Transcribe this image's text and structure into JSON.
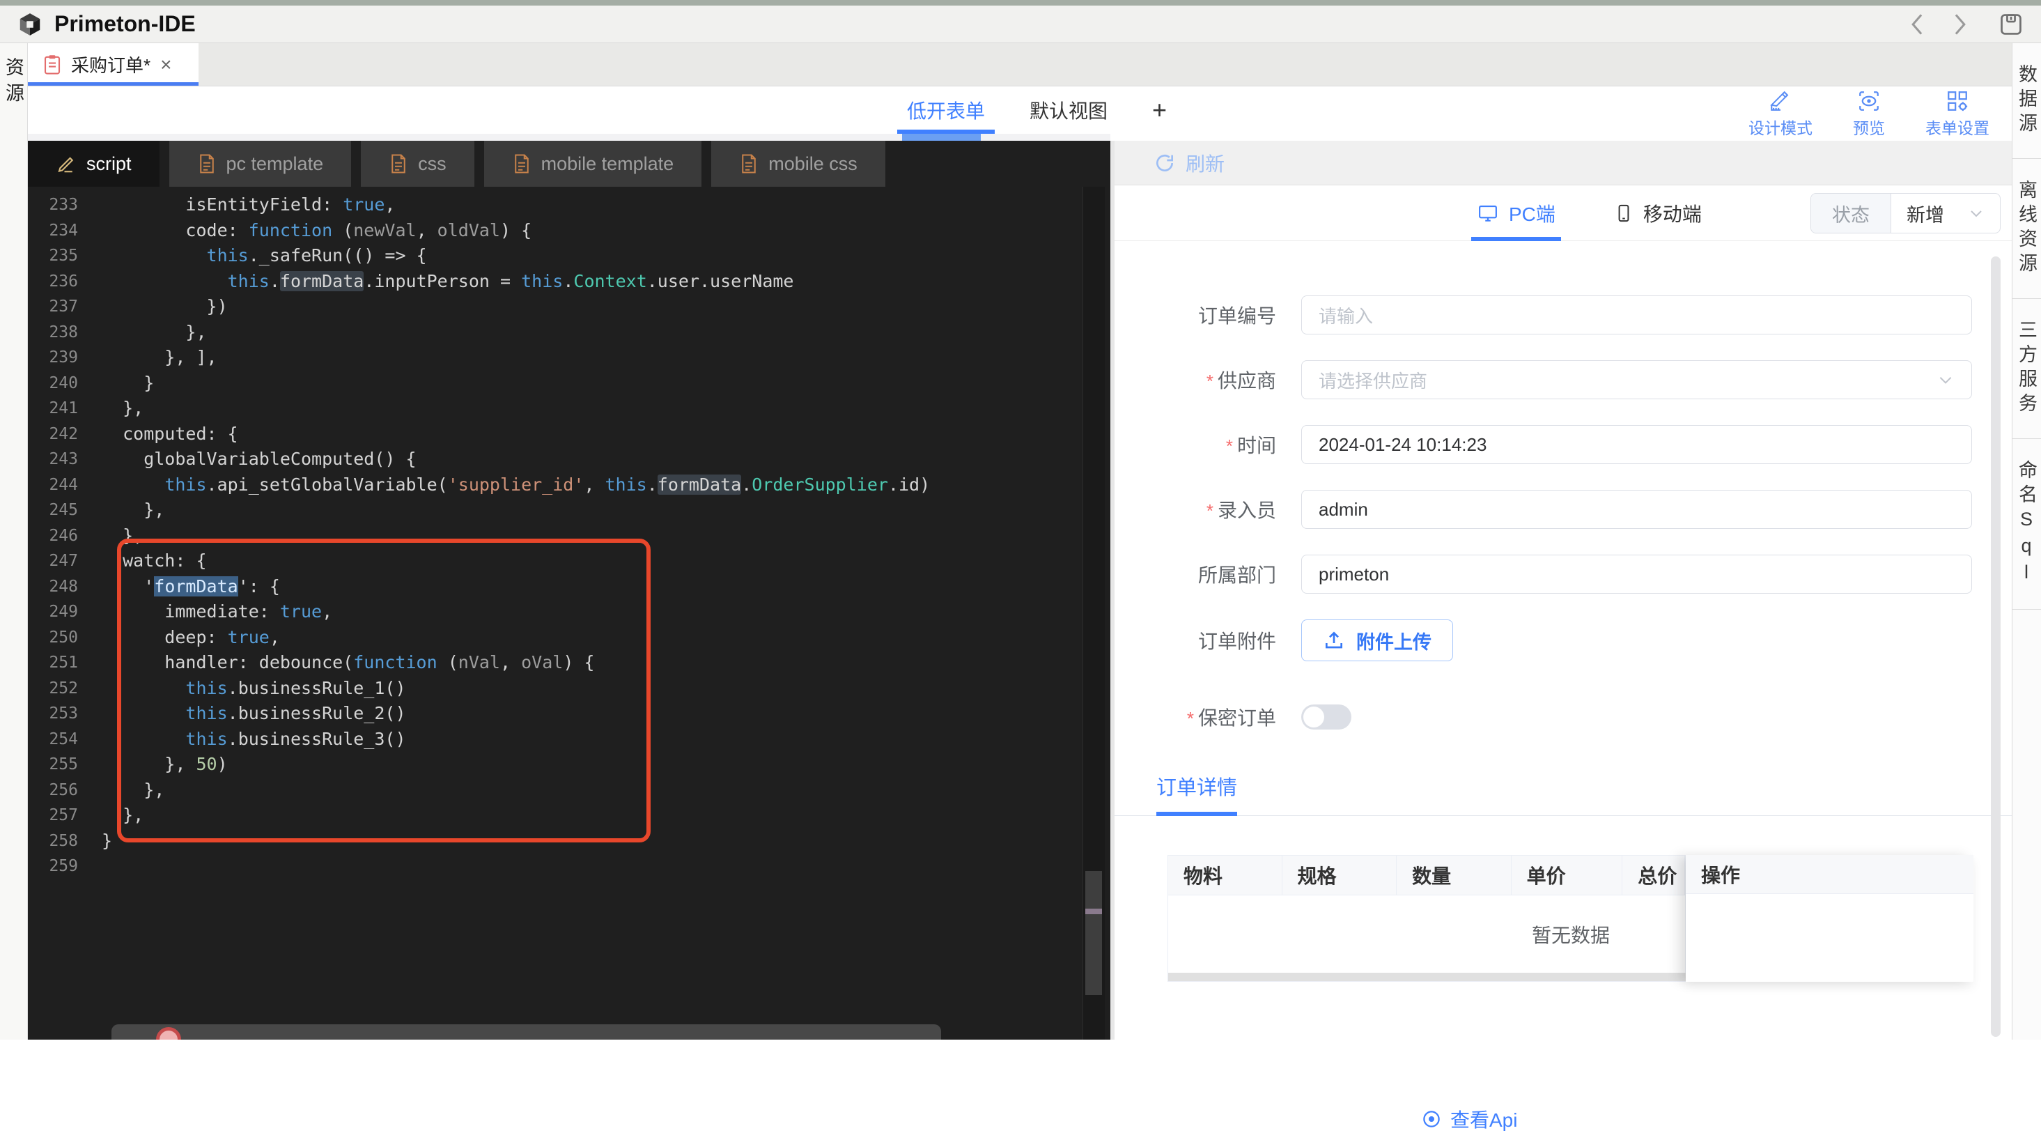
{
  "chrome": {
    "app_title": "Primeton-IDE"
  },
  "left_rail": {
    "label": "资源"
  },
  "doc_tab": {
    "title": "采购订单*",
    "close": "×"
  },
  "view_tabs": {
    "items": [
      {
        "label": "低开表单",
        "active": true
      },
      {
        "label": "默认视图",
        "active": false
      }
    ],
    "add": "+"
  },
  "top_actions": [
    {
      "label": "设计模式",
      "icon": "design-mode-icon"
    },
    {
      "label": "预览",
      "icon": "preview-icon"
    },
    {
      "label": "表单设置",
      "icon": "form-settings-icon"
    }
  ],
  "editor": {
    "tabs": [
      {
        "label": "script",
        "active": true,
        "icon": "pencil-icon"
      },
      {
        "label": "pc template",
        "active": false,
        "icon": "file-icon"
      },
      {
        "label": "css",
        "active": false,
        "icon": "file-icon"
      },
      {
        "label": "mobile template",
        "active": false,
        "icon": "file-icon"
      },
      {
        "label": "mobile css",
        "active": false,
        "icon": "file-icon"
      }
    ],
    "code": [
      {
        "n": 233,
        "s": [
          [
            "pln",
            "        isEntityField: "
          ],
          [
            "kw",
            "true"
          ],
          [
            "pln",
            ","
          ]
        ]
      },
      {
        "n": 234,
        "s": [
          [
            "pln",
            "        code: "
          ],
          [
            "kw",
            "function"
          ],
          [
            "pln",
            " ("
          ],
          [
            "prm",
            "newVal"
          ],
          [
            "pln",
            ", "
          ],
          [
            "prm",
            "oldVal"
          ],
          [
            "pln",
            ") {"
          ]
        ]
      },
      {
        "n": 235,
        "s": [
          [
            "pln",
            "          "
          ],
          [
            "kw",
            "this"
          ],
          [
            "pln",
            "._safeRun(() => {"
          ]
        ]
      },
      {
        "n": 236,
        "s": [
          [
            "pln",
            "            "
          ],
          [
            "kw",
            "this"
          ],
          [
            "pln",
            "."
          ],
          [
            "hl",
            "formData"
          ],
          [
            "pln",
            ".inputPerson = "
          ],
          [
            "kw",
            "this"
          ],
          [
            "pln",
            "."
          ],
          [
            "cls",
            "Context"
          ],
          [
            "pln",
            ".user.userName"
          ]
        ]
      },
      {
        "n": 237,
        "s": [
          [
            "pln",
            "          })"
          ]
        ]
      },
      {
        "n": 238,
        "s": [
          [
            "pln",
            "        },"
          ]
        ]
      },
      {
        "n": 239,
        "s": [
          [
            "pln",
            "      }, ],"
          ]
        ]
      },
      {
        "n": 240,
        "s": [
          [
            "pln",
            "    }"
          ]
        ]
      },
      {
        "n": 241,
        "s": [
          [
            "pln",
            "  },"
          ]
        ]
      },
      {
        "n": 242,
        "s": [
          [
            "pln",
            "  computed: {"
          ]
        ]
      },
      {
        "n": 243,
        "s": [
          [
            "pln",
            "    globalVariableComputed() {"
          ]
        ]
      },
      {
        "n": 244,
        "s": [
          [
            "pln",
            "      "
          ],
          [
            "kw",
            "this"
          ],
          [
            "pln",
            ".api_setGlobalVariable("
          ],
          [
            "str",
            "'supplier_id'"
          ],
          [
            "pln",
            ", "
          ],
          [
            "kw",
            "this"
          ],
          [
            "pln",
            "."
          ],
          [
            "hl",
            "formData"
          ],
          [
            "pln",
            "."
          ],
          [
            "cls",
            "OrderSupplier"
          ],
          [
            "pln",
            ".id)"
          ]
        ]
      },
      {
        "n": 245,
        "s": [
          [
            "pln",
            "    },"
          ]
        ]
      },
      {
        "n": 246,
        "s": [
          [
            "pln",
            "  },"
          ]
        ]
      },
      {
        "n": 247,
        "s": [
          [
            "pln",
            "  watch: {"
          ]
        ]
      },
      {
        "n": 248,
        "s": [
          [
            "pln",
            "    '"
          ],
          [
            "sel",
            "formData"
          ],
          [
            "pln",
            "': {"
          ]
        ]
      },
      {
        "n": 249,
        "s": [
          [
            "pln",
            "      immediate: "
          ],
          [
            "kw",
            "true"
          ],
          [
            "pln",
            ","
          ]
        ]
      },
      {
        "n": 250,
        "s": [
          [
            "pln",
            "      deep: "
          ],
          [
            "kw",
            "true"
          ],
          [
            "pln",
            ","
          ]
        ]
      },
      {
        "n": 251,
        "s": [
          [
            "pln",
            "      handler: debounce("
          ],
          [
            "kw",
            "function"
          ],
          [
            "pln",
            " ("
          ],
          [
            "prm",
            "nVal"
          ],
          [
            "pln",
            ", "
          ],
          [
            "prm",
            "oVal"
          ],
          [
            "pln",
            ") {"
          ]
        ]
      },
      {
        "n": 252,
        "s": [
          [
            "pln",
            "        "
          ],
          [
            "kw",
            "this"
          ],
          [
            "pln",
            ".businessRule_1()"
          ]
        ]
      },
      {
        "n": 253,
        "s": [
          [
            "pln",
            "        "
          ],
          [
            "kw",
            "this"
          ],
          [
            "pln",
            ".businessRule_2()"
          ]
        ]
      },
      {
        "n": 254,
        "s": [
          [
            "pln",
            "        "
          ],
          [
            "kw",
            "this"
          ],
          [
            "pln",
            ".businessRule_3()"
          ]
        ]
      },
      {
        "n": 255,
        "s": [
          [
            "pln",
            "      }, "
          ],
          [
            "num",
            "50"
          ],
          [
            "pln",
            ")"
          ]
        ]
      },
      {
        "n": 256,
        "s": [
          [
            "pln",
            "    },"
          ]
        ]
      },
      {
        "n": 257,
        "s": [
          [
            "pln",
            "  },"
          ]
        ]
      },
      {
        "n": 258,
        "s": [
          [
            "pln",
            "}"
          ]
        ]
      },
      {
        "n": 259,
        "s": []
      }
    ]
  },
  "preview": {
    "refresh_label": "刷新",
    "device_tabs": [
      {
        "label": "PC端",
        "active": true,
        "icon": "monitor-icon"
      },
      {
        "label": "移动端",
        "active": false,
        "icon": "phone-icon"
      }
    ],
    "status": {
      "label": "状态",
      "value": "新增"
    },
    "fields": [
      {
        "key": "order-no",
        "label": "订单编号",
        "required": false,
        "type": "input",
        "value": "",
        "placeholder": "请输入"
      },
      {
        "key": "supplier",
        "label": "供应商",
        "required": true,
        "type": "select",
        "value": "",
        "placeholder": "请选择供应商"
      },
      {
        "key": "time",
        "label": "时间",
        "required": true,
        "type": "input",
        "value": "2024-01-24 10:14:23",
        "placeholder": ""
      },
      {
        "key": "input-person",
        "label": "录入员",
        "required": true,
        "type": "input",
        "value": "admin",
        "placeholder": ""
      },
      {
        "key": "department",
        "label": "所属部门",
        "required": false,
        "type": "input",
        "value": "primeton",
        "placeholder": ""
      },
      {
        "key": "attachment",
        "label": "订单附件",
        "required": false,
        "type": "upload",
        "button_label": "附件上传"
      },
      {
        "key": "secret-order",
        "label": "保密订单",
        "required": true,
        "type": "switch",
        "on": false
      }
    ],
    "section_title": "订单详情",
    "table": {
      "headers": [
        "物料",
        "规格",
        "数量",
        "单价",
        "总价",
        "操作"
      ],
      "empty_text": "暂无数据"
    },
    "api_link": "查看Api"
  },
  "right_rail": {
    "items": [
      "数据源",
      "离线资源",
      "三方服务",
      "命名Sql"
    ]
  }
}
